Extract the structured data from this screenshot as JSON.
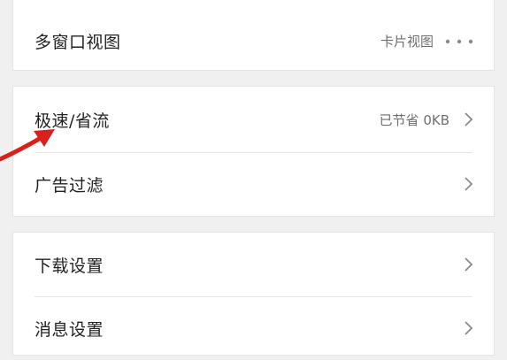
{
  "settings": {
    "groups": [
      {
        "items": [
          {
            "label": "多窗口视图",
            "value": "卡片视图",
            "accessory": "more-dots-icon"
          }
        ]
      },
      {
        "items": [
          {
            "label": "极速/省流",
            "value": "已节省 0KB",
            "accessory": "chevron-right-icon"
          },
          {
            "label": "广告过滤",
            "value": "",
            "accessory": "chevron-right-icon"
          }
        ]
      },
      {
        "items": [
          {
            "label": "下载设置",
            "value": "",
            "accessory": "chevron-right-icon"
          },
          {
            "label": "消息设置",
            "value": "",
            "accessory": "chevron-right-icon"
          }
        ]
      }
    ]
  },
  "annotation": {
    "icon": "red-arrow-icon",
    "color": "#d9211c"
  },
  "colors": {
    "background": "#f0f0f0",
    "card": "#ffffff",
    "label": "#222222",
    "value": "#6f6f6f",
    "chevron": "#8a8a8a"
  }
}
